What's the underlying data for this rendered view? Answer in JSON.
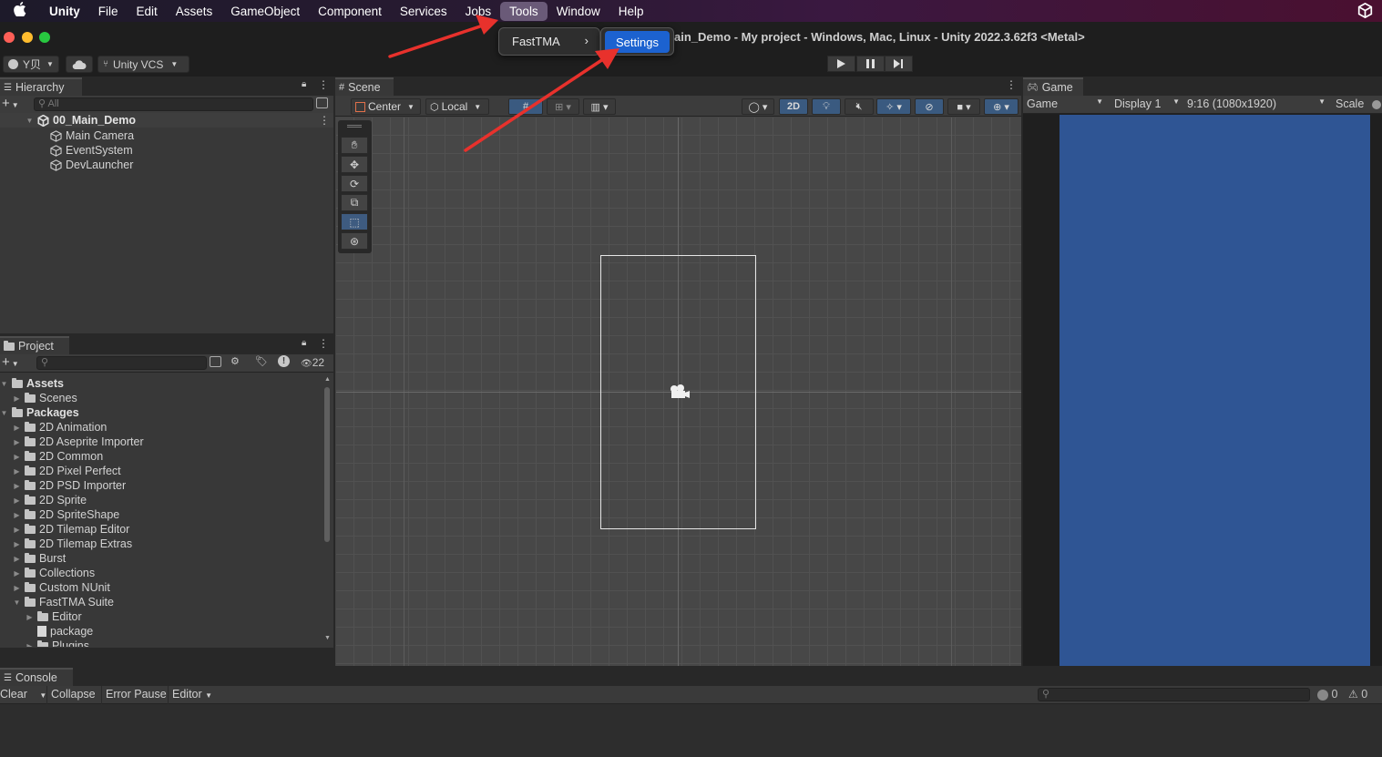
{
  "menubar": {
    "items": [
      "Unity",
      "File",
      "Edit",
      "Assets",
      "GameObject",
      "Component",
      "Services",
      "Jobs",
      "Tools",
      "Window",
      "Help"
    ],
    "active": "Tools"
  },
  "window_title": "ain_Demo - My project - Windows, Mac, Linux - Unity 2022.3.62f3 <Metal>",
  "toolbar": {
    "account_label": "Y贝",
    "vcs_label": "Unity VCS"
  },
  "tools_menu": {
    "item": "FastTMA",
    "submenu_item": "Settings"
  },
  "hierarchy": {
    "tab": "Hierarchy",
    "search_placeholder": "All",
    "scene": "00_Main_Demo",
    "objects": [
      "Main Camera",
      "EventSystem",
      "DevLauncher"
    ]
  },
  "project": {
    "tab": "Project",
    "hidden_count": "22",
    "tree": [
      {
        "label": "Assets",
        "bold": true,
        "level": 0,
        "open": true
      },
      {
        "label": "Scenes",
        "level": 1
      },
      {
        "label": "Packages",
        "bold": true,
        "level": 0,
        "open": true
      },
      {
        "label": "2D Animation",
        "level": 1
      },
      {
        "label": "2D Aseprite Importer",
        "level": 1
      },
      {
        "label": "2D Common",
        "level": 1
      },
      {
        "label": "2D Pixel Perfect",
        "level": 1
      },
      {
        "label": "2D PSD Importer",
        "level": 1
      },
      {
        "label": "2D Sprite",
        "level": 1
      },
      {
        "label": "2D SpriteShape",
        "level": 1
      },
      {
        "label": "2D Tilemap Editor",
        "level": 1
      },
      {
        "label": "2D Tilemap Extras",
        "level": 1
      },
      {
        "label": "Burst",
        "level": 1
      },
      {
        "label": "Collections",
        "level": 1
      },
      {
        "label": "Custom NUnit",
        "level": 1
      },
      {
        "label": "FastTMA Suite",
        "level": 1,
        "open": true
      },
      {
        "label": "Editor",
        "level": 2
      },
      {
        "label": "package",
        "level": 2,
        "file": true
      },
      {
        "label": "Plugins",
        "level": 2
      }
    ]
  },
  "scene": {
    "tab": "Scene",
    "pivot": "Center",
    "space": "Local",
    "mode_2d": "2D"
  },
  "game": {
    "tab": "Game",
    "view": "Game",
    "display": "Display 1",
    "resolution": "9:16 (1080x1920)",
    "scale_label": "Scale",
    "viewport_color": "#2f5594"
  },
  "console": {
    "tab": "Console",
    "clear": "Clear",
    "collapse": "Collapse",
    "error_pause": "Error Pause",
    "editor": "Editor",
    "info_count": "0",
    "warn_count": "0"
  },
  "colors": {
    "accent": "#1c62d0",
    "arrow": "#e8312c"
  }
}
